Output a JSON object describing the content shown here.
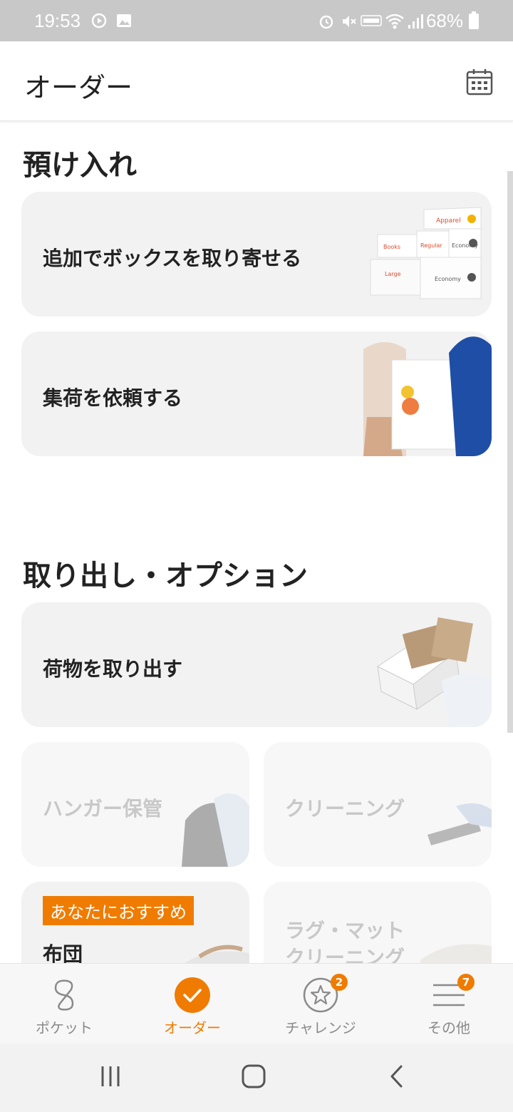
{
  "status_bar": {
    "time": "19:53",
    "battery": "68%",
    "icons": [
      "play-icon",
      "gallery-icon",
      "alarm-icon",
      "mute-icon",
      "volte-icon",
      "wifi-icon",
      "signal-icon",
      "battery-icon"
    ]
  },
  "header": {
    "title": "オーダー",
    "calendar_icon": "calendar-icon"
  },
  "sections": {
    "deposit": {
      "title": "預け入れ",
      "cards": [
        {
          "label": "追加でボックスを取り寄せる",
          "box_labels": [
            "Apparel",
            "Books",
            "Regular",
            "Economy",
            "Large",
            "Economy"
          ]
        },
        {
          "label": "集荷を依頼する"
        }
      ]
    },
    "retrieve": {
      "title": "取り出し・オプション",
      "cards": [
        {
          "label": "荷物を取り出す"
        },
        {
          "label": "ハンガー保管"
        },
        {
          "label": "クリーニング"
        },
        {
          "label": "布団",
          "badge": "あなたにおすすめ"
        },
        {
          "label": "ラグ・マット\nクリーニング",
          "line1": "ラグ・マット",
          "line2": "クリーニング"
        }
      ]
    }
  },
  "bottom_nav": {
    "items": [
      {
        "label": "ポケット",
        "icon": "pocket-logo-icon",
        "active": false
      },
      {
        "label": "オーダー",
        "icon": "check-icon",
        "active": true
      },
      {
        "label": "チャレンジ",
        "icon": "star-icon",
        "badge": "2",
        "active": false
      },
      {
        "label": "その他",
        "icon": "menu-icon",
        "badge": "7",
        "active": false
      }
    ]
  },
  "colors": {
    "accent": "#ef7c00",
    "card_bg": "#f2f2f2",
    "status_bar_bg": "#c8c8c8"
  }
}
